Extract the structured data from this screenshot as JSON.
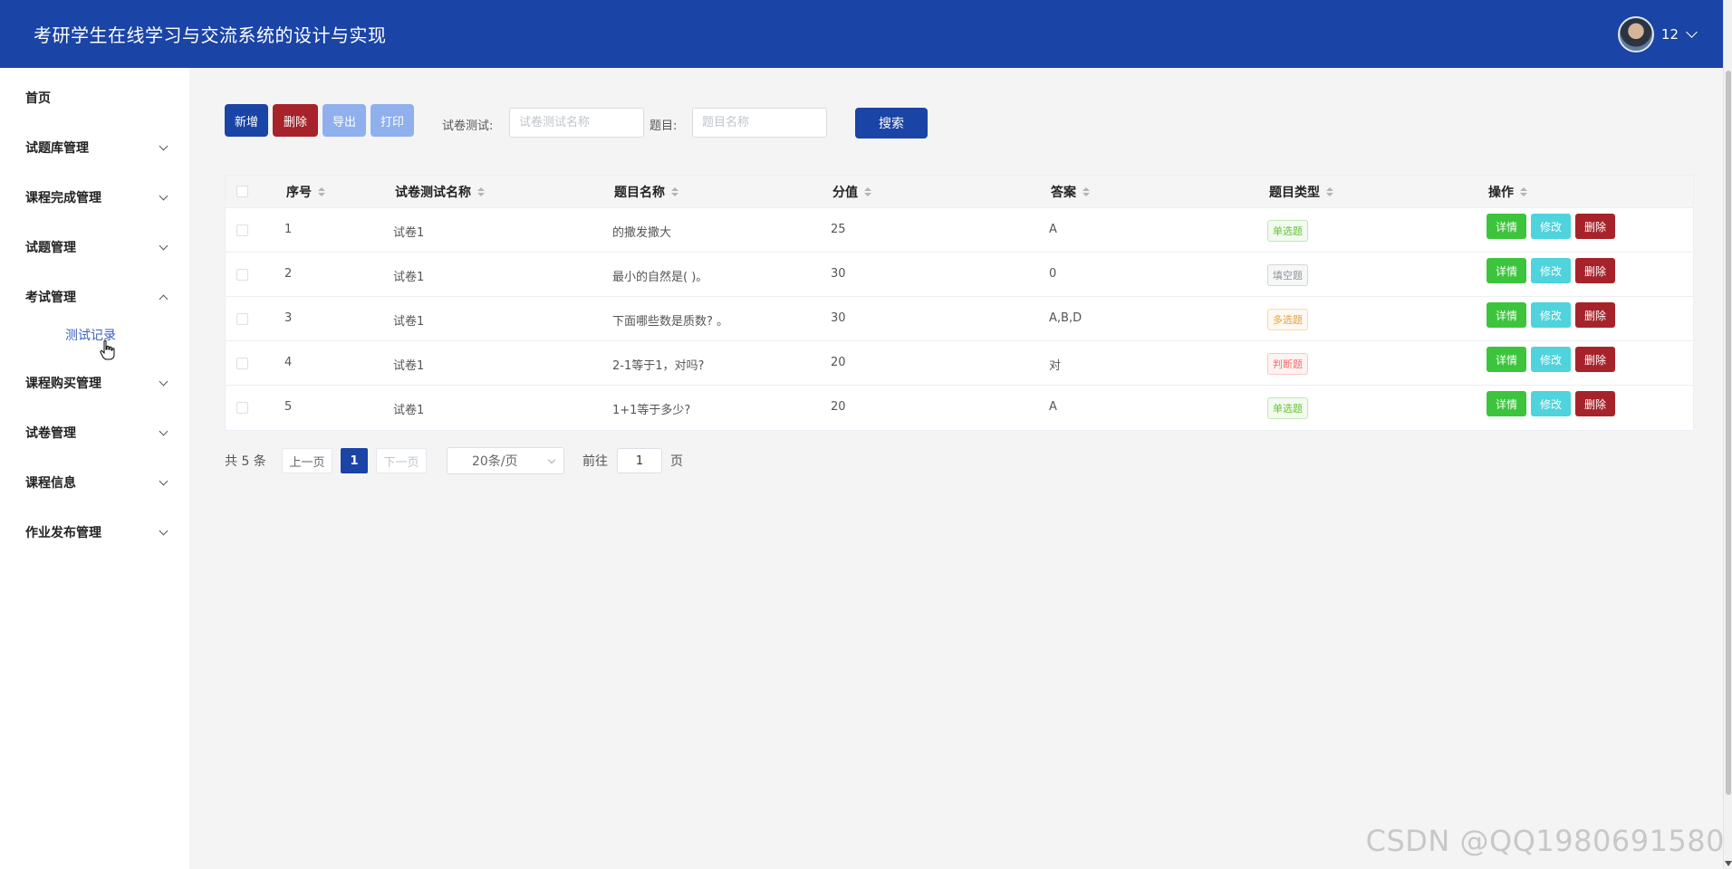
{
  "header": {
    "title": "考研学生在线学习与交流系统的设计与实现",
    "username": "12"
  },
  "sidebar": {
    "items": [
      {
        "label": "首页"
      },
      {
        "label": "试题库管理"
      },
      {
        "label": "课程完成管理"
      },
      {
        "label": "试题管理"
      },
      {
        "label": "考试管理"
      },
      {
        "label": "课程购买管理"
      },
      {
        "label": "试卷管理"
      },
      {
        "label": "课程信息"
      },
      {
        "label": "作业发布管理"
      }
    ],
    "submenu": {
      "label": "测试记录"
    }
  },
  "toolbar": {
    "add_label": "新增",
    "delete_label": "删除",
    "export_label": "导出",
    "print_label": "打印",
    "search_label": "搜索",
    "exam_field_label": "试卷测试:",
    "exam_placeholder": "试卷测试名称",
    "question_field_label": "题目:",
    "question_placeholder": "题目名称"
  },
  "table": {
    "headers": [
      "序号",
      "试卷测试名称",
      "题目名称",
      "分值",
      "答案",
      "题目类型",
      "操作"
    ],
    "rows": [
      {
        "index": "1",
        "exam": "试卷1",
        "question": "的撒发撒大",
        "score": "25",
        "answer": "A",
        "type": "单选题",
        "type_color": "#67c23a"
      },
      {
        "index": "2",
        "exam": "试卷1",
        "question": "最小的自然是( )。",
        "score": "30",
        "answer": "0",
        "type": "填空题",
        "type_color": "#909399"
      },
      {
        "index": "3",
        "exam": "试卷1",
        "question": "下面哪些数是质数? 。",
        "score": "30",
        "answer": "A,B,D",
        "type": "多选题",
        "type_color": "#e6a23c"
      },
      {
        "index": "4",
        "exam": "试卷1",
        "question": "2-1等于1，对吗?",
        "score": "20",
        "answer": "对",
        "type": "判断题",
        "type_color": "#f56c6c"
      },
      {
        "index": "5",
        "exam": "试卷1",
        "question": "1+1等于多少?",
        "score": "20",
        "answer": "A",
        "type": "单选题",
        "type_color": "#67c23a"
      }
    ],
    "actions": {
      "detail": "详情",
      "edit": "修改",
      "delete": "删除"
    }
  },
  "pagination": {
    "total": "共 5 条",
    "prev": "上一页",
    "current": "1",
    "next": "下一页",
    "page_size": "20条/页",
    "goto_label": "前往",
    "goto_value": "1",
    "page_suffix": "页"
  },
  "watermark": "CSDN @QQ1980691580",
  "colors": {
    "primary": "#1a44a6",
    "danger": "#a7232b",
    "success": "#3cc43c",
    "info": "#4fd3dc"
  }
}
